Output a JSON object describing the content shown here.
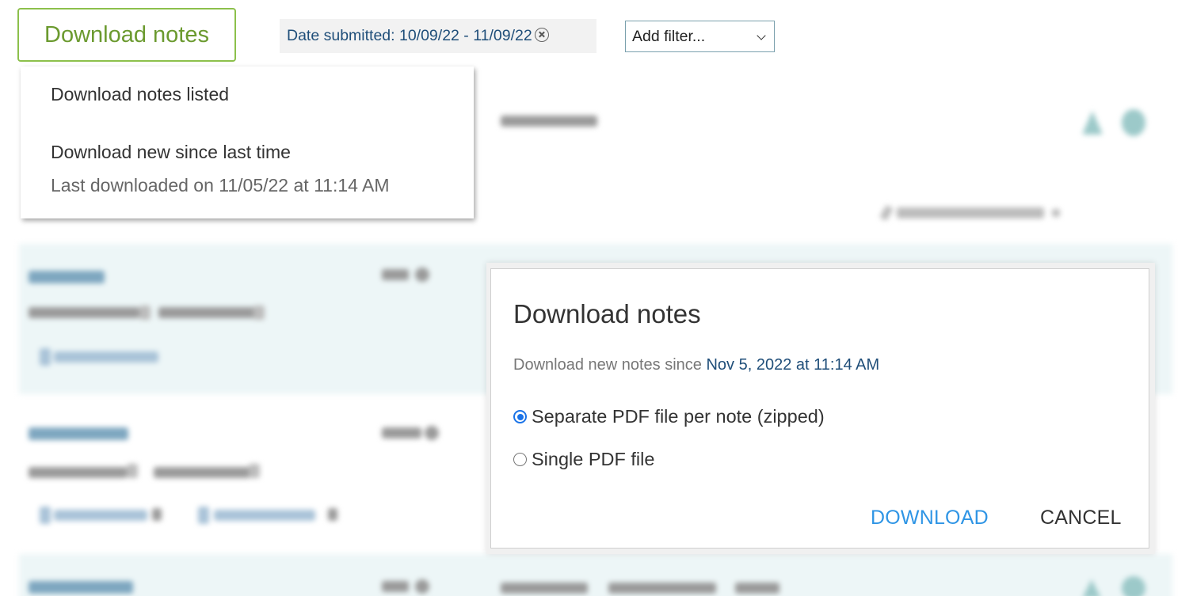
{
  "toolbar": {
    "download_button_label": "Download notes",
    "filter_chip_label": "Date submitted: 10/09/22 - 11/09/22",
    "filter_chip_remove_icon": "circle-x-icon",
    "add_filter_select": {
      "selected": "Add filter...",
      "icon": "chevron-down-icon"
    }
  },
  "download_menu": {
    "items": [
      {
        "label": "Download notes listed"
      },
      {
        "label": "Download new since last time",
        "sublabel": "Last downloaded on 11/05/22 at 11:14 AM"
      }
    ]
  },
  "dialog": {
    "title": "Download notes",
    "description_prefix": "Download new notes since",
    "description_date": "Nov 5, 2022 at 11:14 AM",
    "options": [
      {
        "label": "Separate PDF file per note (zipped)",
        "checked": true
      },
      {
        "label": "Single PDF file",
        "checked": false
      }
    ],
    "buttons": {
      "download": "DOWNLOAD",
      "cancel": "CANCEL"
    }
  },
  "colors": {
    "accent_green": "#8cc04b",
    "link_blue": "#2f95e5",
    "radio_blue": "#1a73e8",
    "date_navy": "#1f4e79",
    "row_tint": "#edf6f7"
  }
}
